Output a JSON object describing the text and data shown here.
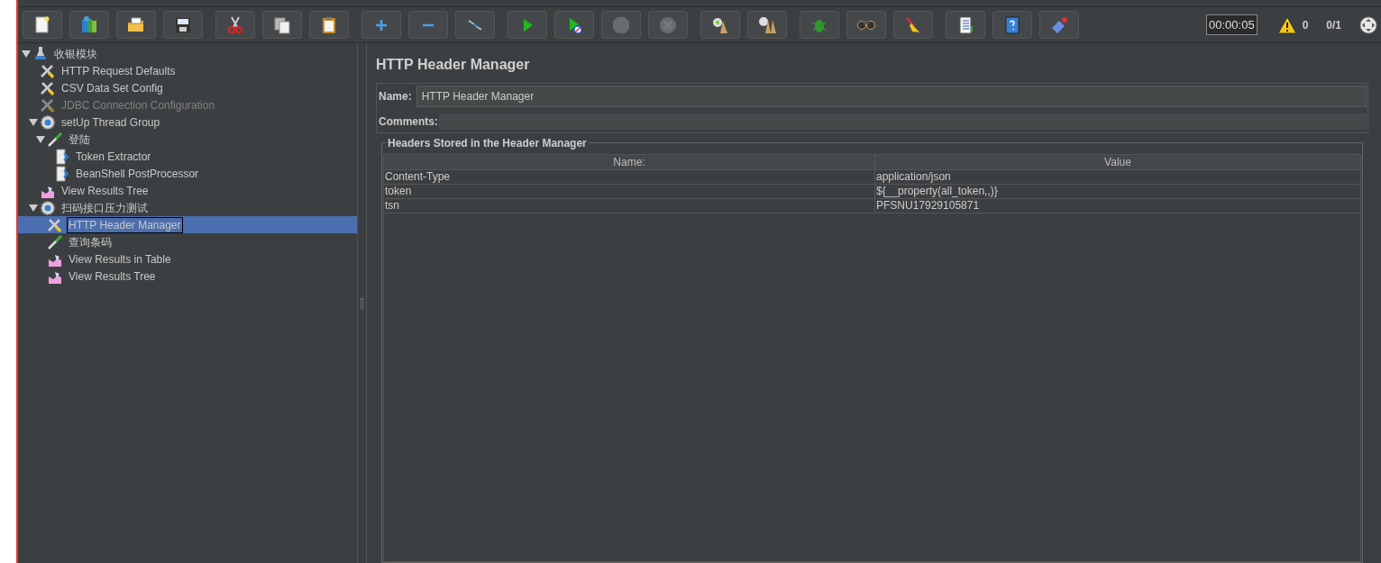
{
  "toolbar": [
    [
      {
        "kind": "new",
        "disabled": false
      },
      {
        "kind": "templates",
        "disabled": false
      },
      {
        "kind": "open",
        "disabled": false
      },
      {
        "kind": "save",
        "disabled": false
      }
    ],
    [
      {
        "kind": "cut",
        "disabled": false
      },
      {
        "kind": "copy",
        "disabled": false
      },
      {
        "kind": "paste",
        "disabled": false
      }
    ],
    [
      {
        "kind": "expand",
        "disabled": false
      },
      {
        "kind": "collapse",
        "disabled": false
      },
      {
        "kind": "toggle",
        "disabled": false
      }
    ],
    [
      {
        "kind": "start",
        "disabled": false
      },
      {
        "kind": "start-no-pause",
        "disabled": false
      },
      {
        "kind": "stop",
        "disabled": true
      },
      {
        "kind": "shutdown",
        "disabled": true
      }
    ],
    [
      {
        "kind": "clear",
        "disabled": false
      },
      {
        "kind": "clear-all",
        "disabled": false
      }
    ],
    [
      {
        "kind": "bug",
        "disabled": false
      },
      {
        "kind": "search",
        "disabled": false
      },
      {
        "kind": "reset-search",
        "disabled": false
      }
    ],
    [
      {
        "kind": "functions",
        "disabled": false
      },
      {
        "kind": "help",
        "disabled": false
      },
      {
        "kind": "remote",
        "disabled": false
      }
    ]
  ],
  "status": {
    "timer": "00:00:05",
    "warnings": "0",
    "threads": "0/1"
  },
  "tree": [
    {
      "label": "收银模块",
      "kind": "testplan",
      "expanded": true,
      "selected": false,
      "disabled": false,
      "children": [
        {
          "label": "HTTP Request Defaults",
          "kind": "config",
          "selected": false,
          "disabled": false
        },
        {
          "label": "CSV Data Set Config",
          "kind": "config",
          "selected": false,
          "disabled": false
        },
        {
          "label": "JDBC Connection Configuration",
          "kind": "config",
          "selected": false,
          "disabled": true
        },
        {
          "label": "setUp Thread Group",
          "kind": "threadgroup",
          "expanded": true,
          "selected": false,
          "disabled": false,
          "children": [
            {
              "label": "登陆",
              "kind": "sampler",
              "expanded": true,
              "selected": false,
              "disabled": false,
              "children": [
                {
                  "label": "Token Extractor",
                  "kind": "postprocessor",
                  "selected": false,
                  "disabled": false
                },
                {
                  "label": "BeanShell PostProcessor",
                  "kind": "postprocessor",
                  "selected": false,
                  "disabled": false
                }
              ]
            }
          ]
        },
        {
          "label": "View Results Tree",
          "kind": "listener",
          "selected": false,
          "disabled": false
        },
        {
          "label": "扫码接口压力测试",
          "kind": "threadgroup",
          "expanded": true,
          "selected": false,
          "disabled": false,
          "children": [
            {
              "label": "HTTP Header Manager",
              "kind": "config",
              "selected": true,
              "disabled": false
            },
            {
              "label": "查询条码",
              "kind": "sampler",
              "selected": false,
              "disabled": false
            },
            {
              "label": "View Results in Table",
              "kind": "listener",
              "selected": false,
              "disabled": false
            },
            {
              "label": "View Results Tree",
              "kind": "listener",
              "selected": false,
              "disabled": false
            }
          ]
        }
      ]
    }
  ],
  "panel": {
    "title": "HTTP Header Manager",
    "name_label": "Name:",
    "name_value": "HTTP Header Manager",
    "comments_label": "Comments:",
    "group_title": "Headers Stored in the Header Manager",
    "table": {
      "columns": [
        "Name:",
        "Value"
      ],
      "rows": [
        [
          "Content-Type",
          "application/json"
        ],
        [
          "token",
          "${__property(all_token,,)}"
        ],
        [
          "tsn",
          "PFSNU17929105871"
        ]
      ]
    }
  }
}
